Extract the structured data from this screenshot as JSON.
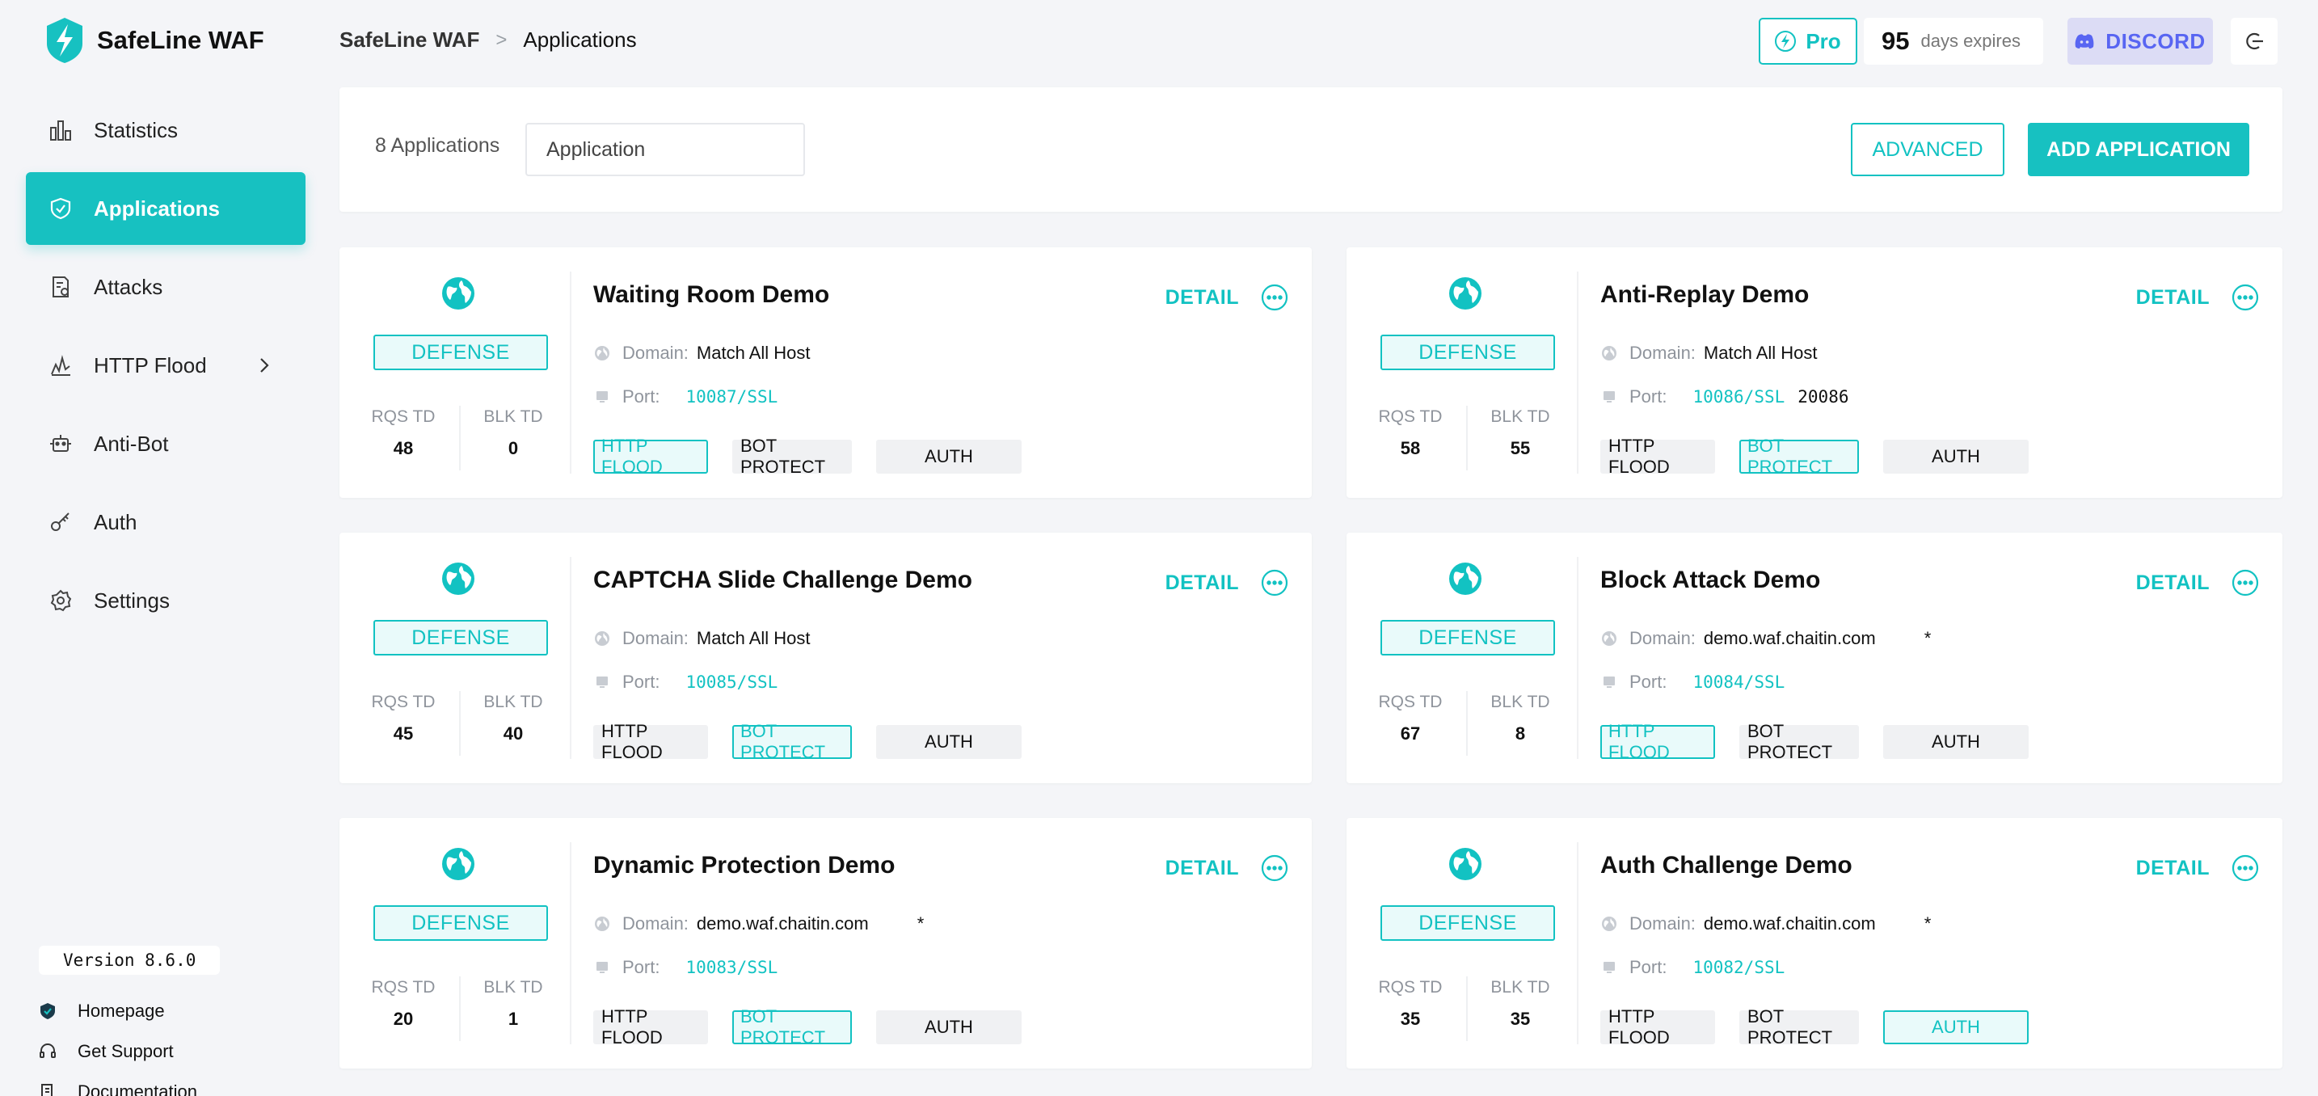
{
  "app": {
    "name": "SafeLine WAF"
  },
  "breadcrumb": {
    "root": "SafeLine WAF",
    "separator": ">",
    "current": "Applications"
  },
  "topbar": {
    "pro_label": "Pro",
    "days_value": "95",
    "days_label": "days expires",
    "discord_label": "DISCORD"
  },
  "sidebar": {
    "items": [
      {
        "label": "Statistics",
        "icon": "bar-chart-icon",
        "active": false
      },
      {
        "label": "Applications",
        "icon": "shield-icon",
        "active": true
      },
      {
        "label": "Attacks",
        "icon": "document-shield-icon",
        "active": false
      },
      {
        "label": "HTTP Flood",
        "icon": "flood-graph-icon",
        "active": false,
        "has_submenu": true
      },
      {
        "label": "Anti-Bot",
        "icon": "robot-icon",
        "active": false
      },
      {
        "label": "Auth",
        "icon": "key-icon",
        "active": false
      },
      {
        "label": "Settings",
        "icon": "gear-icon",
        "active": false
      }
    ],
    "version": "Version 8.6.0",
    "footer_links": [
      {
        "label": "Homepage",
        "icon": "shield-check-icon"
      },
      {
        "label": "Get Support",
        "icon": "headset-icon"
      },
      {
        "label": "Documentation",
        "icon": "book-icon"
      }
    ]
  },
  "toolbar": {
    "count_label": "8 Applications",
    "search_placeholder": "Application",
    "advanced_label": "ADVANCED",
    "add_label": "ADD APPLICATION"
  },
  "labels": {
    "detail": "DETAIL",
    "domain": "Domain:",
    "port": "Port:",
    "rqs": "RQS TD",
    "blk": "BLK TD",
    "defense": "DEFENSE",
    "tag_flood": "HTTP FLOOD",
    "tag_bot": "BOT PROTECT",
    "tag_auth": "AUTH"
  },
  "accent_color": "#12c2c2",
  "applications": [
    {
      "name": "Waiting Room Demo",
      "domain": "Match All Host",
      "domain_extra": "",
      "port": "10087/SSL",
      "port_extra": "",
      "rqs": "48",
      "blk": "0",
      "status": "DEFENSE",
      "http_flood": true,
      "bot_protect": false,
      "auth": false
    },
    {
      "name": "Anti-Replay Demo",
      "domain": "Match All Host",
      "domain_extra": "",
      "port": "10086/SSL",
      "port_extra": "20086",
      "rqs": "58",
      "blk": "55",
      "status": "DEFENSE",
      "http_flood": false,
      "bot_protect": true,
      "auth": false
    },
    {
      "name": "CAPTCHA Slide Challenge Demo",
      "domain": "Match All Host",
      "domain_extra": "",
      "port": "10085/SSL",
      "port_extra": "",
      "rqs": "45",
      "blk": "40",
      "status": "DEFENSE",
      "http_flood": false,
      "bot_protect": true,
      "auth": false
    },
    {
      "name": "Block Attack Demo",
      "domain": "demo.waf.chaitin.com",
      "domain_extra": "*",
      "port": "10084/SSL",
      "port_extra": "",
      "rqs": "67",
      "blk": "8",
      "status": "DEFENSE",
      "http_flood": true,
      "bot_protect": false,
      "auth": false
    },
    {
      "name": "Dynamic Protection Demo",
      "domain": "demo.waf.chaitin.com",
      "domain_extra": "*",
      "port": "10083/SSL",
      "port_extra": "",
      "rqs": "20",
      "blk": "1",
      "status": "DEFENSE",
      "http_flood": false,
      "bot_protect": true,
      "auth": false
    },
    {
      "name": "Auth Challenge Demo",
      "domain": "demo.waf.chaitin.com",
      "domain_extra": "*",
      "port": "10082/SSL",
      "port_extra": "",
      "rqs": "35",
      "blk": "35",
      "status": "DEFENSE",
      "http_flood": false,
      "bot_protect": false,
      "auth": true
    }
  ]
}
